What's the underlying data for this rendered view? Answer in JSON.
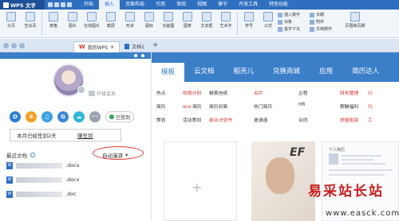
{
  "titlebar": {
    "app_name": "WPS 文字",
    "menus": [
      "开始",
      "插入",
      "页面布局",
      "引用",
      "审阅",
      "视图",
      "章节",
      "开发工具",
      "特色功能"
    ],
    "active_menu": "插入"
  },
  "toolbar": {
    "groups": [
      "分页",
      "空白页",
      "表格",
      "图片",
      "在线图片",
      "截屏",
      "形状",
      "图标",
      "功能图",
      "图表",
      "文本框",
      "艺术字",
      "符号",
      "公式",
      "页眉和页脚"
    ],
    "small_items": [
      "插入数字",
      "对象",
      "首字下沉",
      "日期",
      "附件",
      "文档部件"
    ]
  },
  "tabs": [
    {
      "label": "我的WPS",
      "active": true
    },
    {
      "label": "文档1",
      "active": false
    }
  ],
  "sidebar": {
    "vip_label": "升级会员",
    "verified_label": "已签到",
    "days_text": "本月已经签到2天",
    "days_link": "赚签到",
    "recent_label": "最近文档",
    "sync_label": "自动漫游",
    "files": [
      ".docx",
      ".docx",
      ".doc"
    ]
  },
  "nav": [
    "模板",
    "云文档",
    "稻壳儿",
    "兑换商城",
    "应用",
    "简历达人"
  ],
  "links": [
    [
      "热点",
      "热销计划",
      "精美信纸",
      "名片",
      "企程",
      "财务管理",
      "行"
    ],
    [
      "简历",
      "NEW 简历",
      "简历封面",
      "热门简历",
      "HR",
      "薪酬福利",
      "行"
    ],
    [
      "策划",
      "活动策划",
      "商业计划书",
      "邀请函",
      "合同",
      "房屋租赁",
      "工"
    ]
  ],
  "red_links": [
    "热销计划",
    "名片",
    "财务管理",
    "行",
    "商业计划书",
    "房屋租赁",
    "工"
  ],
  "cards": {
    "card2_text": "EF",
    "card3_title": "个人简历"
  },
  "watermark": {
    "text": "易采站长站",
    "url": "www.easck.com"
  },
  "colors": {
    "brand": "#3b7fc9",
    "highlight": "#e03a3a"
  }
}
